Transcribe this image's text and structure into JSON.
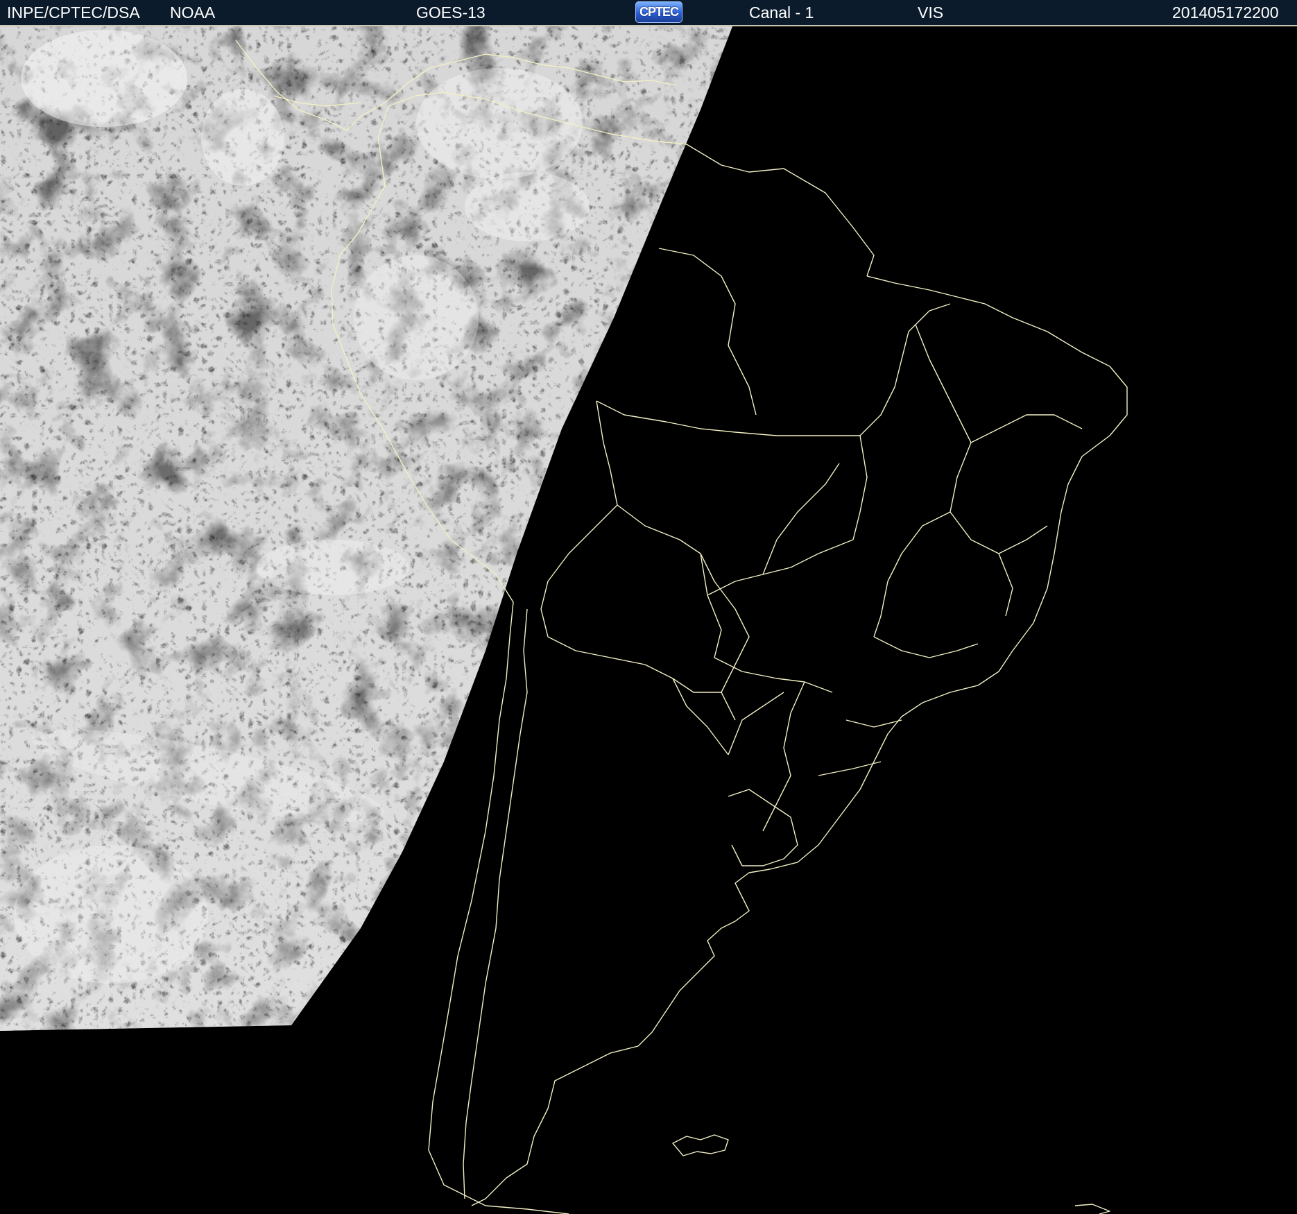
{
  "header": {
    "agency": "INPE/CPTEC/DSA",
    "source": "NOAA",
    "satellite": "GOES-13",
    "logo_text": "CPTEC",
    "channel": "Canal - 1",
    "band": "VIS",
    "timestamp": "201405172200"
  },
  "colors": {
    "header_bg": "#0b1b2b",
    "header_text": "#ffffff",
    "border_lines": "#f2efc4",
    "night_side": "#000000",
    "cloud_gray": "#7a7a7a"
  },
  "map": {
    "projection": "satellite view",
    "region": "South America",
    "illumination": "day side west, night side east"
  }
}
